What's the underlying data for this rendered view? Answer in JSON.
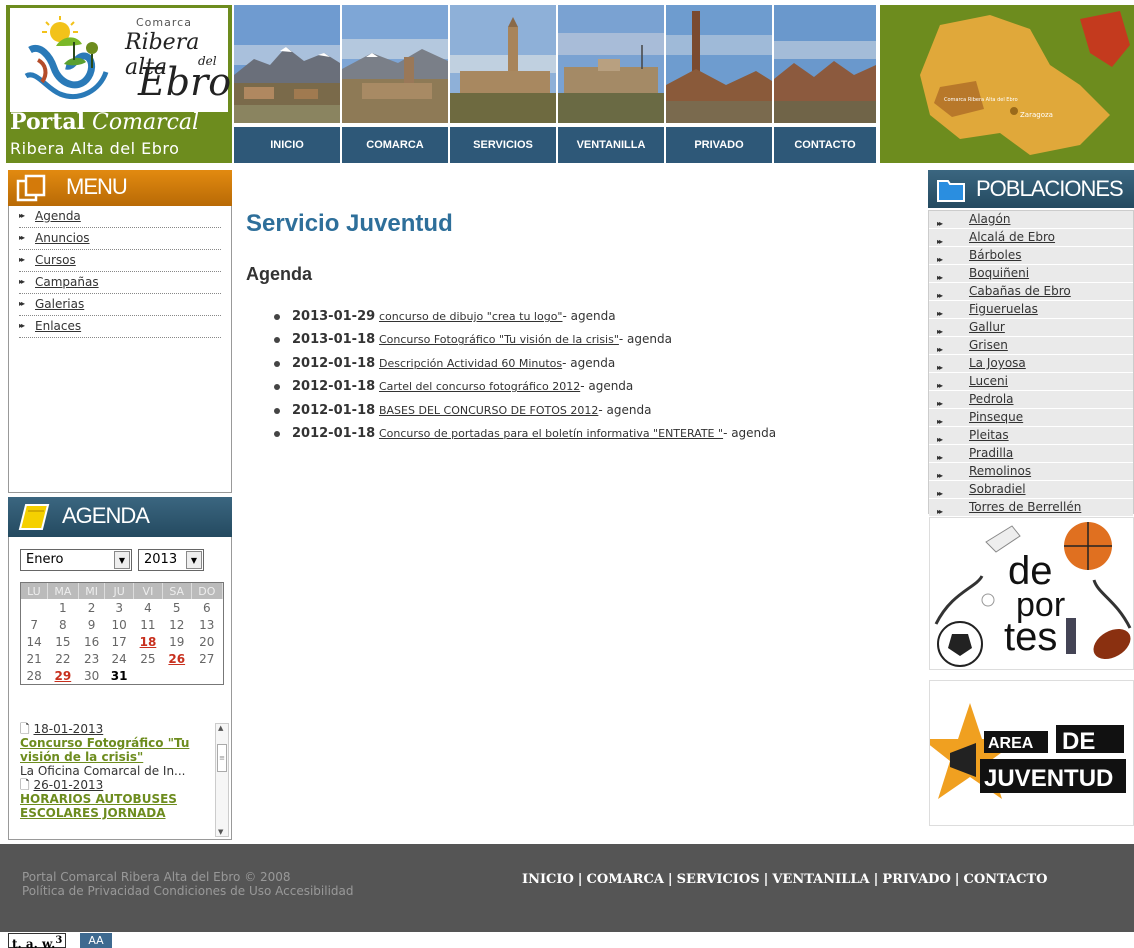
{
  "header": {
    "logo": {
      "comarca": "Comarca",
      "ribera": "Ribera alta",
      "del": "del",
      "ebro": "Ebro",
      "portal_bold": "Portal",
      "portal_italic": "Comarcal",
      "subtitle": "Ribera Alta del Ebro"
    },
    "nav": [
      "INICIO",
      "COMARCA",
      "SERVICIOS",
      "VENTANILLA",
      "PRIVADO",
      "CONTACTO"
    ],
    "map": {
      "label_region": "Comarca Ribera Alta del Ebro",
      "label_city": "Zaragoza"
    }
  },
  "menu": {
    "title": "MENU",
    "items": [
      "Agenda",
      "Anuncios",
      "Cursos",
      "Campañas",
      "Galerias",
      "Enlaces"
    ]
  },
  "agenda_widget": {
    "title": "AGENDA",
    "month": "Enero",
    "year": "2013",
    "weekdays": [
      "LU",
      "MA",
      "MI",
      "JU",
      "VI",
      "SA",
      "DO"
    ],
    "weeks": [
      [
        "",
        "1",
        "2",
        "3",
        "4",
        "5",
        "6"
      ],
      [
        "7",
        "8",
        "9",
        "10",
        "11",
        "12",
        "13"
      ],
      [
        "14",
        "15",
        "16",
        "17",
        "18",
        "19",
        "20"
      ],
      [
        "21",
        "22",
        "23",
        "24",
        "25",
        "26",
        "27"
      ],
      [
        "28",
        "29",
        "30",
        "31",
        "",
        "",
        ""
      ]
    ],
    "event_days": [
      "18",
      "26",
      "29"
    ],
    "today": "31",
    "news": [
      {
        "date": "18-01-2013",
        "title": "Concurso Fotográfico \"Tu visión de la crisis\"",
        "text": "La Oficina Comarcal de In..."
      },
      {
        "date": "26-01-2013",
        "title": "HORARIOS AUTOBUSES ESCOLARES JORNADA",
        "text": ""
      }
    ]
  },
  "main": {
    "title": "Servicio Juventud",
    "section": "Agenda",
    "entries": [
      {
        "date": "2013-01-29",
        "link": "concurso de dibujo \"crea tu logo\"",
        "suffix": "- agenda"
      },
      {
        "date": "2013-01-18",
        "link": "Concurso Fotográfico \"Tu visión de la crisis\"",
        "suffix": "- agenda"
      },
      {
        "date": "2012-01-18",
        "link": "Descripción Actividad 60 Minutos",
        "suffix": "- agenda"
      },
      {
        "date": "2012-01-18",
        "link": "Cartel del concurso fotográfico 2012",
        "suffix": "- agenda"
      },
      {
        "date": "2012-01-18",
        "link": "BASES DEL CONCURSO DE FOTOS 2012",
        "suffix": "- agenda"
      },
      {
        "date": "2012-01-18",
        "link": "Concurso de portadas para el boletín informativa \"ENTERATE \"",
        "suffix": "- agenda"
      }
    ]
  },
  "poblaciones": {
    "title": "POBLACIONES",
    "items": [
      "Alagón",
      "Alcalá de Ebro",
      "Bárboles",
      "Boquiñeni",
      "Cabañas de Ebro",
      "Figueruelas",
      "Gallur",
      "Grisen",
      "La Joyosa",
      "Luceni",
      "Pedrola",
      "Pinseque",
      "Pleitas",
      "Pradilla",
      "Remolinos",
      "Sobradiel",
      "Torres de Berrellén"
    ]
  },
  "banners": {
    "deportes": {
      "l1": "de",
      "l2": "por",
      "l3": "tes"
    },
    "juventud": {
      "l1": "AREA",
      "l2": "DE",
      "l3": "JUVENTUD"
    }
  },
  "footer": {
    "line1": "Portal Comarcal Ribera Alta del Ebro © 2008",
    "line2": "Política de Privacidad Condiciones de Uso Accesibilidad",
    "links": [
      "INICIO",
      "COMARCA",
      "SERVICIOS",
      "VENTANILLA",
      "PRIVADO",
      "CONTACTO"
    ],
    "taw": "t. a. w.",
    "taw_sup": "3",
    "aa": "AA"
  },
  "colors": {
    "olive": "#6d8c1e",
    "navy": "#2e5878",
    "orange": "#e28a10",
    "title_blue": "#2e6f9a",
    "event_red": "#c8301e",
    "footer_gray": "#555555"
  }
}
